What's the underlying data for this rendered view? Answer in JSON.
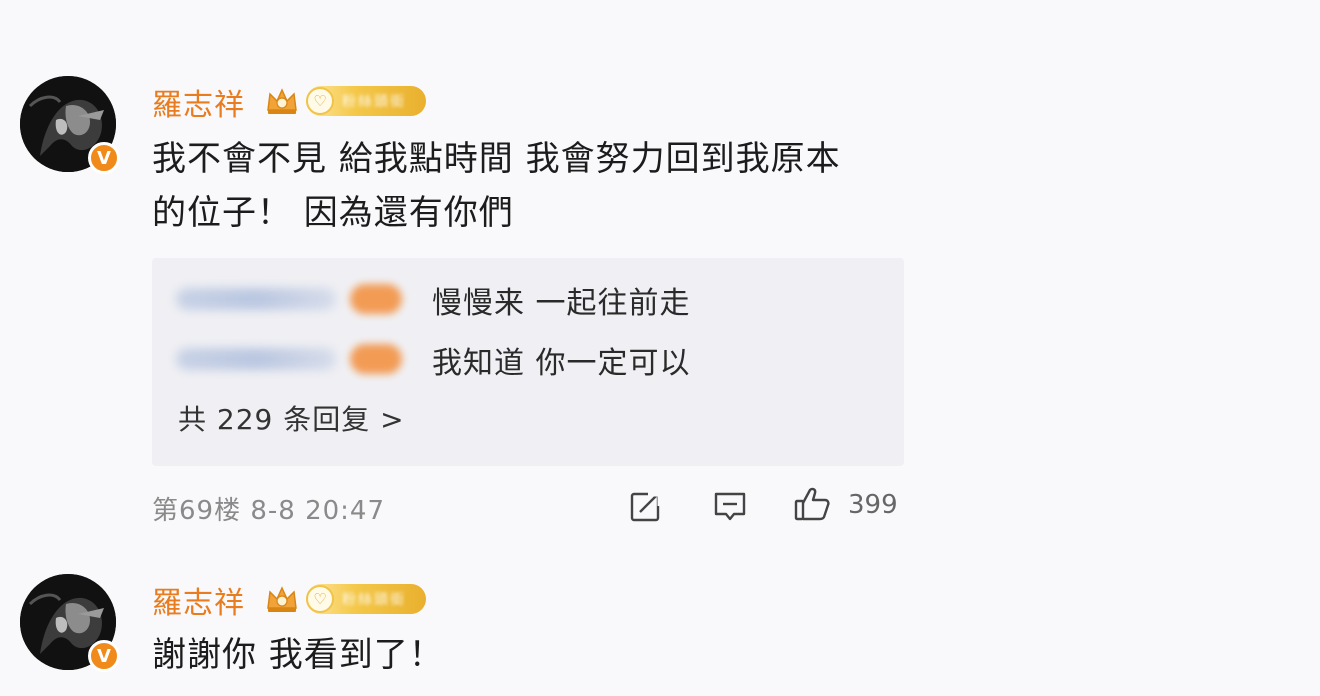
{
  "comments": [
    {
      "username": "羅志祥",
      "verified_badge": "V",
      "level_badge_blur": "粉絲頭銜",
      "text_line1": "我不會不見 給我點時間 我會努力回到我原本",
      "text_line2": "的位子！ 因為還有你們",
      "replies": [
        {
          "text": "慢慢来 一起往前走"
        },
        {
          "text": "我知道 你一定可以"
        }
      ],
      "reply_summary": "共 229 条回复 >",
      "meta": "第69楼 8-8 20:47",
      "like_count": "399",
      "icons": [
        "share-icon",
        "comment-icon",
        "like-icon"
      ]
    },
    {
      "username": "羅志祥",
      "verified_badge": "V",
      "level_badge_blur": "粉絲頭銜",
      "text": "謝謝你 我看到了！"
    }
  ],
  "colors": {
    "username": "#e97c1e",
    "badge_orange": "#f08a1a",
    "reply_bg": "#f0f0f4",
    "meta_gray": "#8a8a8a"
  }
}
